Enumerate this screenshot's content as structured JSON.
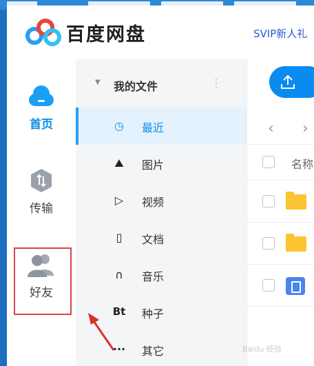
{
  "header": {
    "app_title": "百度网盘",
    "promo": "SVIP新人礼"
  },
  "rail": {
    "items": [
      {
        "label": "首页",
        "icon": "cloud-icon",
        "active": true
      },
      {
        "label": "传输",
        "icon": "transfer-icon",
        "active": false
      },
      {
        "label": "好友",
        "icon": "friends-icon",
        "active": false
      }
    ]
  },
  "tree": {
    "title": "我的文件",
    "more_icon": "more-vertical-icon",
    "items": [
      {
        "label": "最近",
        "icon": "clock-icon",
        "glyph": "◷",
        "active": true
      },
      {
        "label": "图片",
        "icon": "image-icon",
        "glyph": "⛰",
        "active": false
      },
      {
        "label": "视频",
        "icon": "play-icon",
        "glyph": "▷",
        "active": false
      },
      {
        "label": "文档",
        "icon": "document-icon",
        "glyph": "▯",
        "active": false
      },
      {
        "label": "音乐",
        "icon": "headphones-icon",
        "glyph": "∩",
        "active": false
      },
      {
        "label": "种子",
        "icon": "bt-icon",
        "glyph": "Bt",
        "active": false
      },
      {
        "label": "其它",
        "icon": "more-icon",
        "glyph": "···",
        "active": false
      }
    ]
  },
  "content": {
    "upload_icon": "upload-icon",
    "back_glyph": "‹",
    "forward_glyph": "›",
    "column_name": "名称"
  },
  "watermark": "Baidu 经验",
  "colors": {
    "accent": "#0a8bf0",
    "highlight_box": "#d94343",
    "folder": "#fcc433"
  }
}
